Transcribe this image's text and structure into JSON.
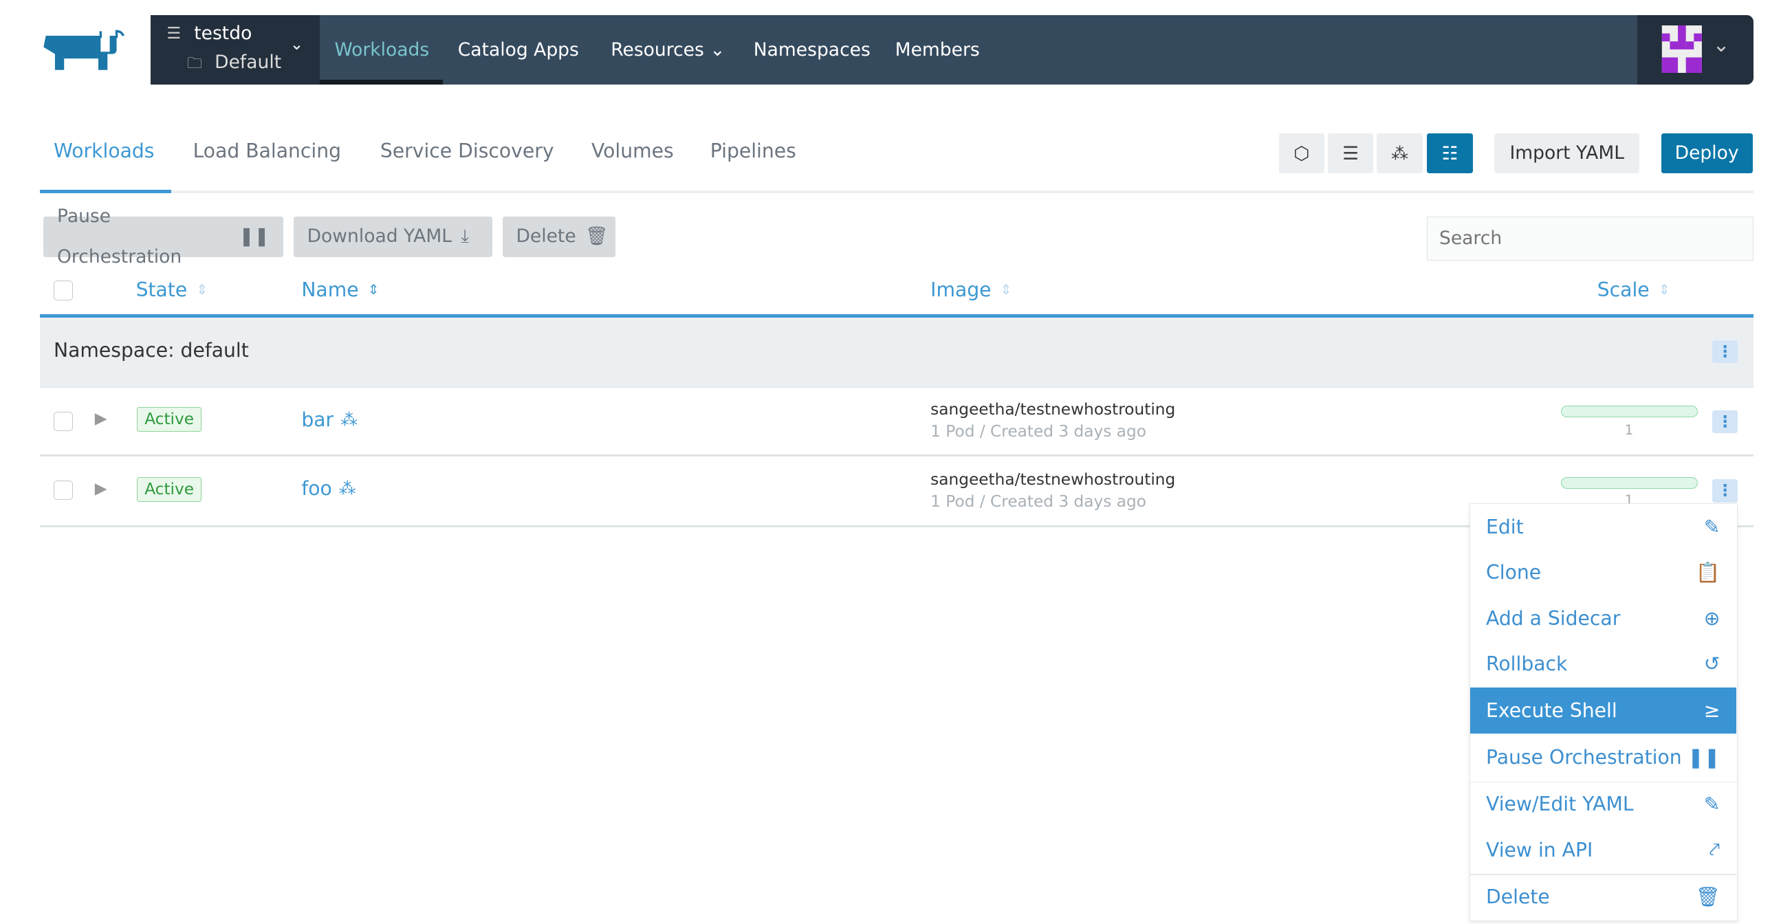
{
  "header": {
    "cluster_name": "testdo",
    "project_name": "Default",
    "nav": [
      {
        "label": "Workloads",
        "active": true
      },
      {
        "label": "Catalog Apps"
      },
      {
        "label": "Resources"
      },
      {
        "label": "Namespaces"
      },
      {
        "label": "Members"
      }
    ]
  },
  "colors": {
    "primary": "#0a76a8",
    "link": "#3d98d3",
    "nav_active": "#79c5cc",
    "active_badge": "#2e9a3c",
    "menu_highlight": "#3a94d4"
  },
  "tabs": [
    {
      "label": "Workloads",
      "active": true
    },
    {
      "label": "Load Balancing"
    },
    {
      "label": "Service Discovery"
    },
    {
      "label": "Volumes"
    },
    {
      "label": "Pipelines"
    }
  ],
  "view_buttons": [
    "cube-icon",
    "server-icon",
    "cubes-icon",
    "list-icon"
  ],
  "toolbar": {
    "import_yaml": "Import YAML",
    "deploy": "Deploy",
    "pause": "Pause Orchestration",
    "download": "Download YAML",
    "delete": "Delete",
    "search_placeholder": "Search"
  },
  "table": {
    "columns": {
      "state": "State",
      "name": "Name",
      "image": "Image",
      "scale": "Scale"
    },
    "group": "Namespace: default",
    "rows": [
      {
        "state": "Active",
        "name": "bar",
        "image": "sangeetha/testnewhostrouting",
        "detail": "1 Pod / Created 3 days ago",
        "scale": "1"
      },
      {
        "state": "Active",
        "name": "foo",
        "image": "sangeetha/testnewhostrouting",
        "detail": "1 Pod / Created 3 days ago",
        "scale": "1"
      }
    ]
  },
  "menu": [
    {
      "label": "Edit",
      "icon": "pencil-icon"
    },
    {
      "label": "Clone",
      "icon": "clipboard-icon"
    },
    {
      "label": "Add a Sidecar",
      "icon": "plus-circle-icon"
    },
    {
      "label": "Rollback",
      "icon": "history-icon"
    },
    {
      "label": "Execute Shell",
      "icon": "terminal-icon",
      "highlighted": true
    },
    {
      "label": "Pause Orchestration",
      "icon": "pause-icon"
    },
    {
      "label": "View/Edit YAML",
      "icon": "pencil-icon"
    },
    {
      "label": "View in API",
      "icon": "external-link-icon"
    },
    {
      "label": "Delete",
      "icon": "trash-icon"
    }
  ]
}
